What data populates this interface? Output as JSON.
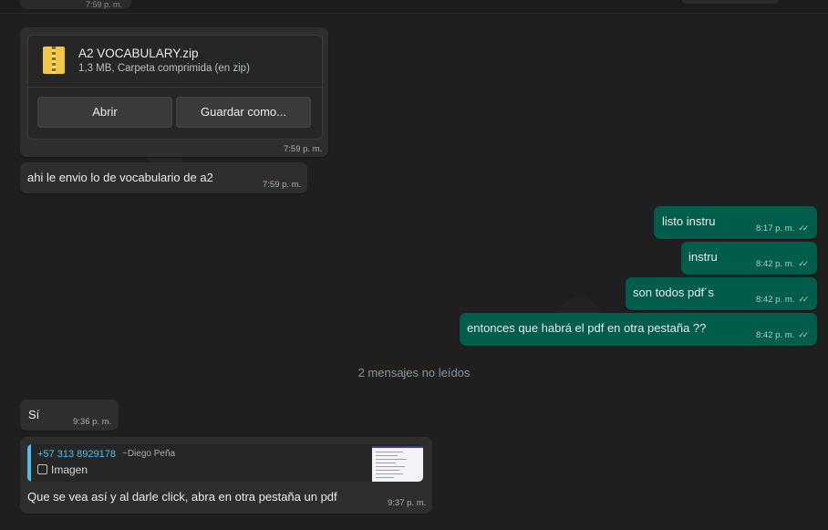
{
  "top": {
    "prev_time": "7:59 p. m."
  },
  "file_message": {
    "file_name": "A2 VOCABULARY.zip",
    "file_desc": "1,3 MB, Carpeta comprimida (en zip)",
    "open_label": "Abrir",
    "save_label": "Guardar como...",
    "time": "7:59 p. m."
  },
  "messages": [
    {
      "text": "ahi le envio lo de vocabulario de a2",
      "time": "7:59 p. m."
    },
    {
      "text": "listo instru",
      "time": "8:17 p. m."
    },
    {
      "text": "instru",
      "time": "8:42 p. m."
    },
    {
      "text": "son todos pdf´s",
      "time": "8:42 p. m."
    },
    {
      "text": "entonces que habrá el pdf en otra pestaña ??",
      "time": "8:42 p. m."
    }
  ],
  "unread_separator": "2 mensajes no leídos",
  "incoming_after": {
    "text": "Sí",
    "time": "9:36 p. m."
  },
  "reply_message": {
    "quoted_number": "+57 313 8929178",
    "quoted_name": "~Diego Peña",
    "quoted_type": "Imagen",
    "text": "Que se vea así y al darle click, abra en otra pestaña un pdf",
    "time": "9:37 p. m."
  },
  "colors": {
    "background": "#1f1f1f",
    "incoming_bubble": "#2e2e2e",
    "outgoing_bubble": "#005c4b",
    "quote_accent": "#53bdeb"
  }
}
